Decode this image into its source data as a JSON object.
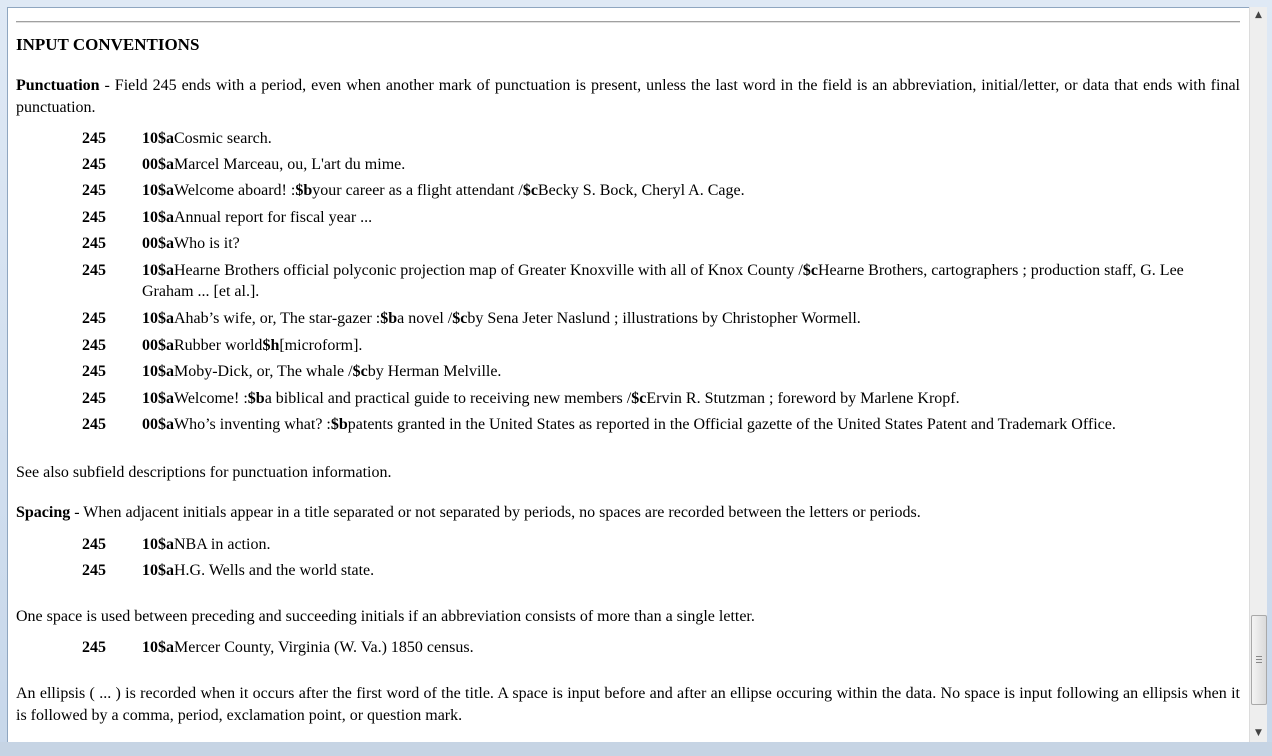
{
  "heading": "INPUT CONVENTIONS",
  "punctuation": {
    "label": "Punctuation",
    "text": " - Field 245 ends with a period, even when another mark of punctuation is present, unless the last word in the field is an abbreviation, initial/letter, or data that ends with final punctuation."
  },
  "punct_examples": [
    {
      "tag": "245",
      "parts": [
        [
          "b",
          "10$a"
        ],
        [
          "t",
          "Cosmic search."
        ]
      ]
    },
    {
      "tag": "245",
      "parts": [
        [
          "b",
          "00$a"
        ],
        [
          "t",
          "Marcel Marceau, ou, L'art du mime."
        ]
      ]
    },
    {
      "tag": "245",
      "parts": [
        [
          "b",
          "10$a"
        ],
        [
          "t",
          "Welcome aboard! :"
        ],
        [
          "b",
          "$b"
        ],
        [
          "t",
          "your career as a flight attendant /"
        ],
        [
          "b",
          "$c"
        ],
        [
          "t",
          "Becky S. Bock, Cheryl A. Cage."
        ]
      ]
    },
    {
      "tag": "245",
      "parts": [
        [
          "b",
          "10$a"
        ],
        [
          "t",
          "Annual report for fiscal year ..."
        ]
      ]
    },
    {
      "tag": "245",
      "parts": [
        [
          "b",
          "00$a"
        ],
        [
          "t",
          "Who is it?"
        ]
      ]
    },
    {
      "tag": "245",
      "parts": [
        [
          "b",
          "10$a"
        ],
        [
          "t",
          "Hearne Brothers official polyconic projection map of Greater Knoxville with all of Knox County /"
        ],
        [
          "b",
          "$c"
        ],
        [
          "t",
          "Hearne Brothers, cartographers ; production staff, G. Lee Graham ... [et al.]."
        ]
      ]
    },
    {
      "tag": "245",
      "parts": [
        [
          "b",
          "10$a"
        ],
        [
          "t",
          "Ahab’s wife, or, The star-gazer :"
        ],
        [
          "b",
          "$b"
        ],
        [
          "t",
          "a novel /"
        ],
        [
          "b",
          "$c"
        ],
        [
          "t",
          "by Sena Jeter Naslund ; illustrations by Christopher Wormell."
        ]
      ]
    },
    {
      "tag": "245",
      "parts": [
        [
          "b",
          "00$a"
        ],
        [
          "t",
          "Rubber world"
        ],
        [
          "b",
          "$h"
        ],
        [
          "t",
          "[microform]."
        ]
      ]
    },
    {
      "tag": "245",
      "parts": [
        [
          "b",
          "10$a"
        ],
        [
          "t",
          "Moby-Dick, or, The whale /"
        ],
        [
          "b",
          "$c"
        ],
        [
          "t",
          "by Herman Melville."
        ]
      ]
    },
    {
      "tag": "245",
      "parts": [
        [
          "b",
          "10$a"
        ],
        [
          "t",
          "Welcome! :"
        ],
        [
          "b",
          "$b"
        ],
        [
          "t",
          "a biblical and practical guide to receiving new members /"
        ],
        [
          "b",
          "$c"
        ],
        [
          "t",
          "Ervin R. Stutzman ; foreword by Marlene Kropf."
        ]
      ]
    },
    {
      "tag": "245",
      "parts": [
        [
          "b",
          "00$a"
        ],
        [
          "t",
          "Who’s inventing what? :"
        ],
        [
          "b",
          "$b"
        ],
        [
          "t",
          "patents granted in the United States as reported in the Official gazette of the United States Patent and Trademark Office."
        ]
      ]
    }
  ],
  "see_also": "See also subfield descriptions for punctuation information.",
  "spacing": {
    "label": "Spacing",
    "text": " - When adjacent initials appear in a title separated or not separated by periods, no spaces are recorded between the letters or periods."
  },
  "spacing_examples": [
    {
      "tag": "245",
      "parts": [
        [
          "b",
          "10$a"
        ],
        [
          "t",
          "NBA in action."
        ]
      ]
    },
    {
      "tag": "245",
      "parts": [
        [
          "b",
          "10$a"
        ],
        [
          "t",
          "H.G. Wells and the world state."
        ]
      ]
    }
  ],
  "one_space": "One space is used between preceding and succeeding initials if an abbreviation consists of more than a single letter.",
  "one_space_examples": [
    {
      "tag": "245",
      "parts": [
        [
          "b",
          "10$a"
        ],
        [
          "t",
          "Mercer County, Virginia (W. Va.) 1850 census."
        ]
      ]
    }
  ],
  "ellipsis": "An ellipsis ( ... ) is recorded when it occurs after the first word of the title. A space is input before and after an ellipse occuring within the data. No space is input following an ellipsis when it is followed by a comma, period, exclamation point, or question mark.",
  "scrollbar": {
    "up_icon": "▲",
    "down_icon": "▼"
  }
}
